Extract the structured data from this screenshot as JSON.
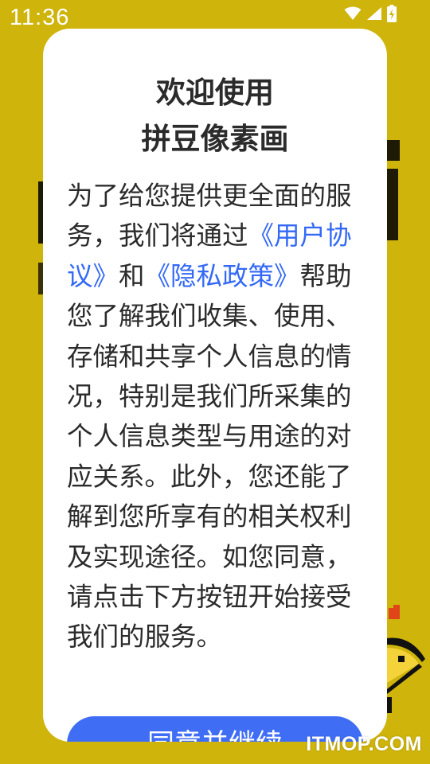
{
  "status_bar": {
    "time": "11:36",
    "icons": [
      "wifi-icon",
      "signal-icon",
      "battery-charging-icon"
    ]
  },
  "colors": {
    "background": "#CFB40B",
    "link": "#3369F6",
    "button": "#3F6EF5"
  },
  "dialog": {
    "title_line1": "欢迎使用",
    "title_line2": "拼豆像素画",
    "body_before": "为了给您提供更全面的服务，我们将通过",
    "link_user_agreement": "《用户协议》",
    "body_and": "和",
    "link_privacy_policy": "《隐私政策》",
    "body_after": "帮助您了解我们收集、使用、存储和共享个人信息的情况，特别是我们所采集的个人信息类型与用途的对应关系。此外，您还能了解到您所享有的相关权利及实现途径。如您同意，请点击下方按钮开始接受我们的服务。",
    "agree_button": "同意并继续"
  },
  "watermark": "ITMOP.COM"
}
